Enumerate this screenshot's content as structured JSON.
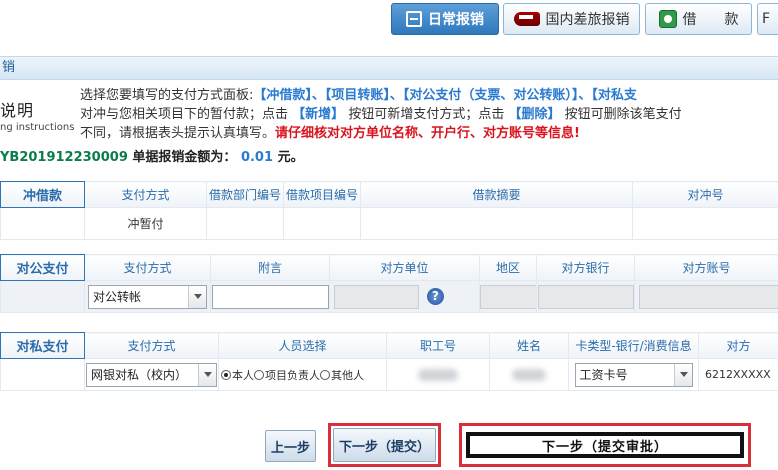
{
  "tabs": [
    {
      "label": "日常报销",
      "icon": "form-icon",
      "active": true
    },
    {
      "label": "国内差旅报销",
      "icon": "train-icon",
      "active": false
    },
    {
      "label": "借　　款",
      "icon": "book-icon",
      "active": false
    },
    {
      "label": "F",
      "icon": "",
      "active": false
    }
  ],
  "section_title": "销",
  "description": {
    "title": "说明",
    "subtitle": "ng instructions",
    "line1_prefix": "选择您要填写的支付方式面板:",
    "line1_options": "【冲借款】、【项目转账】、【对公支付（支票、对公转账）】、【对私支",
    "line2_a": "对冲与您相关项目下的暂付款；点击",
    "line2_new": "【新增】",
    "line2_b": "按钮可新增支付方式；点击",
    "line2_delete": "【删除】",
    "line2_c": "按钮可删除该笔支付",
    "line3_a": "不同，请根据表头提示认真填写。",
    "line3_warning": "请仔细核对对方单位名称、开户行、对方账号等信息!"
  },
  "bill": {
    "number": "YB201912230009",
    "amount_label": "单据报销金额为：",
    "amount": "0.01",
    "unit": "元。"
  },
  "offset_table": {
    "label": "冲借款",
    "headers": [
      "支付方式",
      "借款部门编号",
      "借款项目编号",
      "借款摘要",
      "对冲号"
    ],
    "row": {
      "pay_method": "冲暂付"
    }
  },
  "public_table": {
    "label": "对公支付",
    "headers": [
      "支付方式",
      "附言",
      "对方单位",
      "地区",
      "对方银行",
      "对方账号"
    ],
    "row": {
      "pay_method": "对公转帐",
      "help": "?"
    }
  },
  "private_table": {
    "label": "对私支付",
    "headers": [
      "支付方式",
      "人员选择",
      "职工号",
      "姓名",
      "卡类型-银行/消费信息",
      "对方"
    ],
    "row": {
      "pay_method": "网银对私（校内）",
      "radio_self": "本人",
      "radio_leader": "项目负责人",
      "radio_other": "其他人",
      "card_type": "工资卡号",
      "account": "6212XXXXX"
    }
  },
  "buttons": {
    "prev": "上一步",
    "next_submit": "下一步（提交）",
    "next_approve": "下一步（提交审批）"
  },
  "colors": {
    "accent": "#2e75b8",
    "highlight_border": "#d6303a",
    "warning_text": "#d9141e",
    "bill_number": "#0b7d4a"
  }
}
